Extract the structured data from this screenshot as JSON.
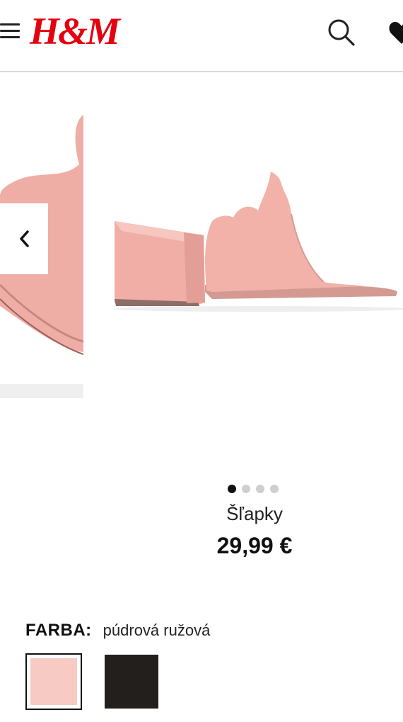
{
  "header": {
    "logo_text": "H&M",
    "brand_color": "#e50010",
    "icons": [
      "menu-icon",
      "search-icon",
      "heart-icon"
    ]
  },
  "gallery": {
    "dots_total": 4,
    "active_dot": 1,
    "prev_arrow_icon": "chevron-left-icon",
    "product_color": "#f2b2aa"
  },
  "product": {
    "name": "Šľapky",
    "price": "29,99 €"
  },
  "color_selector": {
    "label": "FARBA:",
    "selected_value": "púdrová ružová",
    "swatches": [
      {
        "color": "#f7cbc3",
        "selected": true
      },
      {
        "color": "#221f1c",
        "selected": false
      }
    ]
  }
}
